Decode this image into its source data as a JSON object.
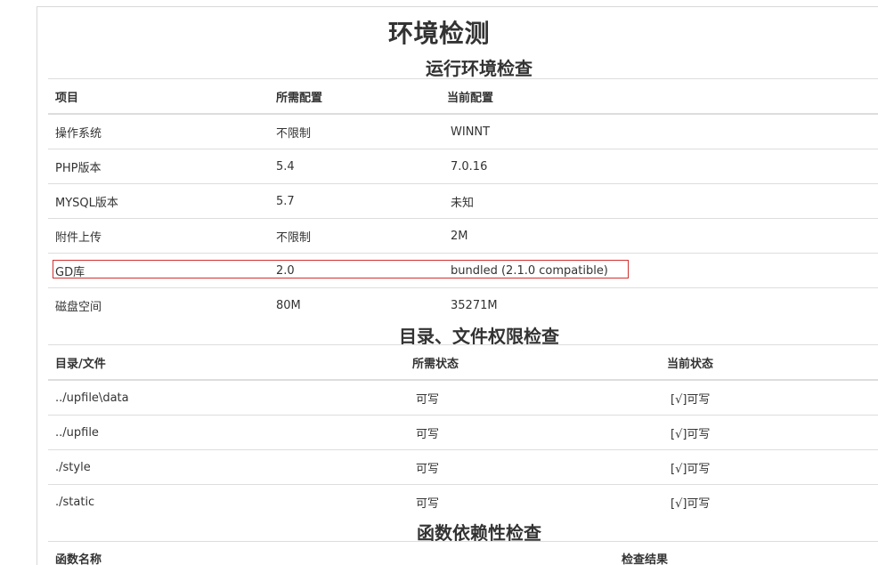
{
  "page": {
    "title": "环境检测"
  },
  "runtime_section": {
    "title": "运行环境检查",
    "headers": [
      "项目",
      "所需配置",
      "当前配置"
    ],
    "rows": [
      [
        "操作系统",
        "不限制",
        "WINNT"
      ],
      [
        "PHP版本",
        "5.4",
        "7.0.16"
      ],
      [
        "MYSQL版本",
        "5.7",
        "未知"
      ],
      [
        "附件上传",
        "不限制",
        "2M"
      ],
      [
        "GD库",
        "2.0",
        "bundled (2.1.0 compatible)"
      ],
      [
        "磁盘空间",
        "80M",
        "35271M"
      ]
    ]
  },
  "dir_section": {
    "title": "目录、文件权限检查",
    "headers": [
      "目录/文件",
      "所需状态",
      "当前状态"
    ],
    "rows": [
      [
        "../upfile\\data",
        "可写",
        "[√]可写"
      ],
      [
        "../upfile",
        "可写",
        "[√]可写"
      ],
      [
        "./style",
        "可写",
        "[√]可写"
      ],
      [
        "./static",
        "可写",
        "[√]可写"
      ]
    ]
  },
  "func_section": {
    "title": "函数依赖性检查",
    "headers": [
      "函数名称",
      "检查结果"
    ]
  },
  "colors": {
    "highlight_border": "#d32f2f",
    "rule": "#dddddd"
  }
}
